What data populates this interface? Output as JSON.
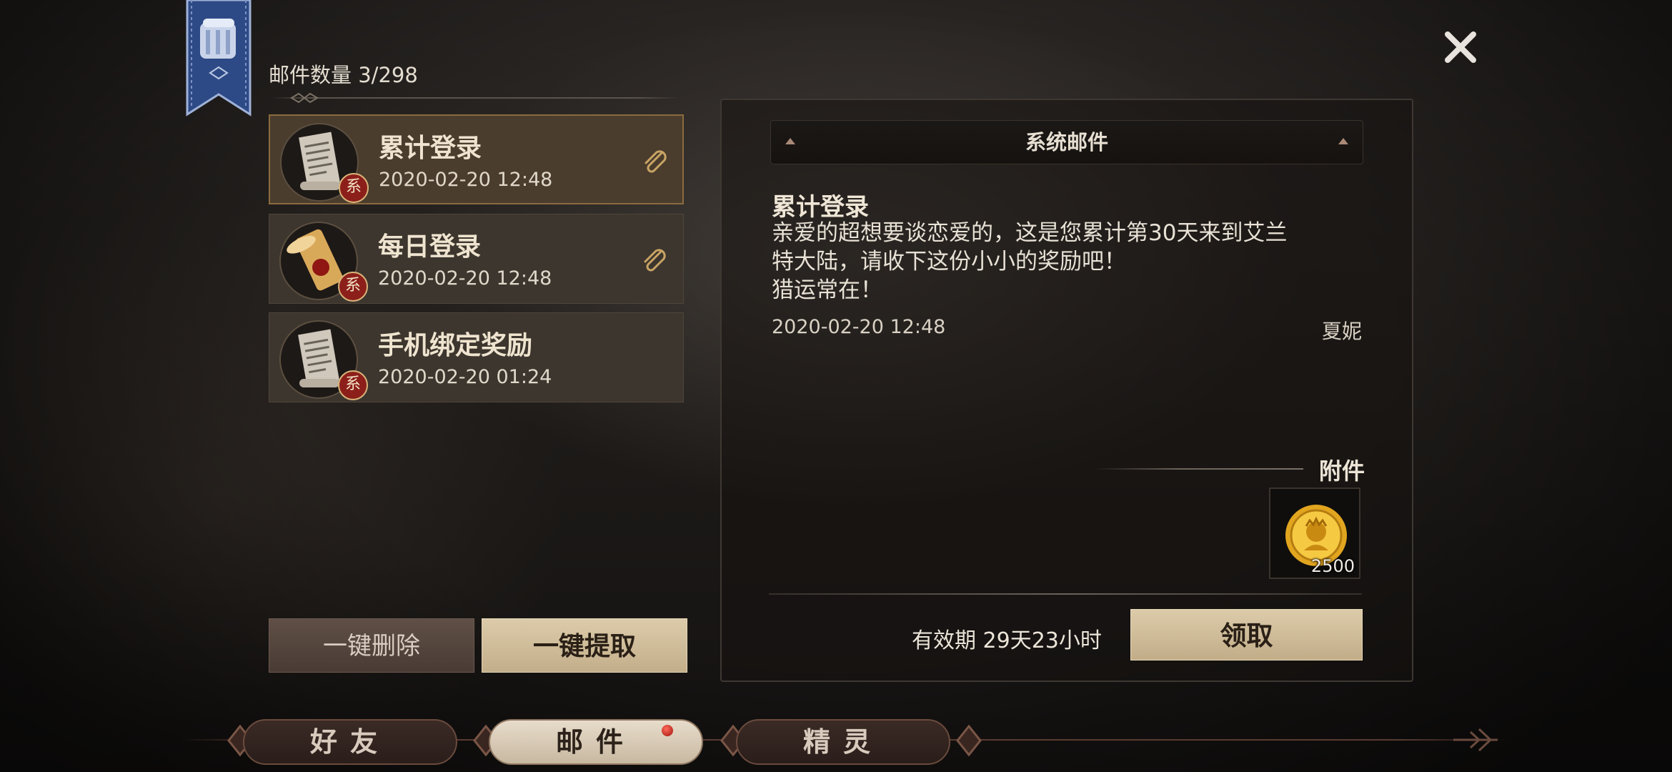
{
  "header": {
    "mail_count_label": "邮件数量 3/298"
  },
  "mail_list": [
    {
      "title": "累计登录",
      "time": "2020-02-20 12:48",
      "badge": "系",
      "has_attachment": true,
      "selected": true,
      "thumb_icon": "scroll-letter-icon"
    },
    {
      "title": "每日登录",
      "time": "2020-02-20 12:48",
      "badge": "系",
      "has_attachment": true,
      "selected": false,
      "thumb_icon": "gold-scroll-icon"
    },
    {
      "title": "手机绑定奖励",
      "time": "2020-02-20 01:24",
      "badge": "系",
      "has_attachment": false,
      "selected": false,
      "thumb_icon": "scroll-letter-icon"
    }
  ],
  "actions": {
    "delete_all": "一键删除",
    "claim_all": "一键提取"
  },
  "detail": {
    "header": "系统邮件",
    "title": "累计登录",
    "body_lines": [
      "亲爱的超想要谈恋爱的，这是您累计第30天来到艾兰",
      "特大陆，请收下这份小小的奖励吧！",
      "猎运常在！"
    ],
    "time": "2020-02-20 12:48",
    "sender": "夏妮",
    "attachment_label": "附件",
    "attachments": [
      {
        "icon": "gold-coin-icon",
        "quantity": "2500"
      }
    ],
    "validity": "有效期 29天23小时",
    "claim": "领取"
  },
  "tabs": [
    {
      "label": "好友",
      "active": false,
      "notify": false
    },
    {
      "label": "邮件",
      "active": true,
      "notify": true
    },
    {
      "label": "精灵",
      "active": false,
      "notify": false
    }
  ],
  "colors": {
    "accent_gold": "#c8b38e",
    "selected_border": "#8a6b3f",
    "badge_red": "#8c1f1a"
  }
}
